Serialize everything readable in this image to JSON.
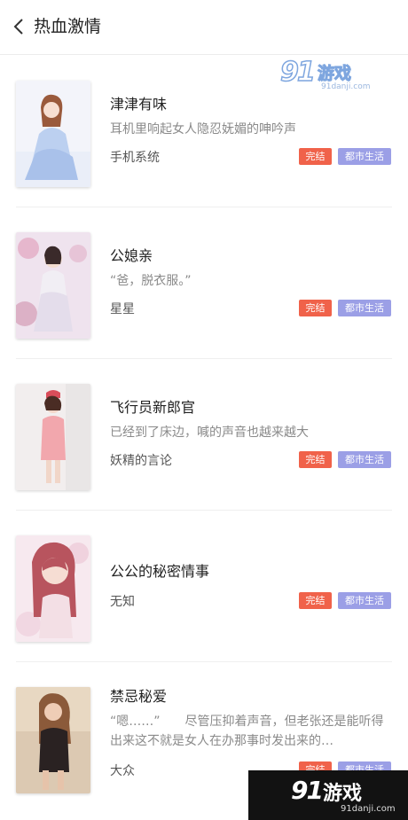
{
  "header": {
    "back_icon": "chevron-left-icon",
    "title": "热血激情"
  },
  "watermark_top": {
    "num": "91",
    "text": "游戏",
    "url": "91danji.com"
  },
  "books": [
    {
      "title": "津津有味",
      "desc": "耳机里响起女人隐忍妩媚的呻吟声",
      "author": "手机系统",
      "status": "完结",
      "genre": "都市生活"
    },
    {
      "title": "公媳亲",
      "desc": "“爸，脱衣服。”",
      "author": "星星",
      "status": "完结",
      "genre": "都市生活"
    },
    {
      "title": "飞行员新郎官",
      "desc": "已经到了床边，喊的声音也越来越大",
      "author": "妖精的言论",
      "status": "完结",
      "genre": "都市生活"
    },
    {
      "title": "公公的秘密情事",
      "desc": "",
      "author": "无知",
      "status": "完结",
      "genre": "都市生活"
    },
    {
      "title": "禁忌秘爱",
      "desc": "“嗯……”　　尽管压抑着声音，但老张还是能听得出来这不就是女人在办那事时发出来的…",
      "author": "大众",
      "status": "完结",
      "genre": "都市生活"
    }
  ],
  "watermark_bottom": {
    "num": "91",
    "text": "游戏",
    "url": "91danji.com"
  },
  "colors": {
    "status_tag": "#f0624a",
    "genre_tag": "#9b9fe6"
  }
}
